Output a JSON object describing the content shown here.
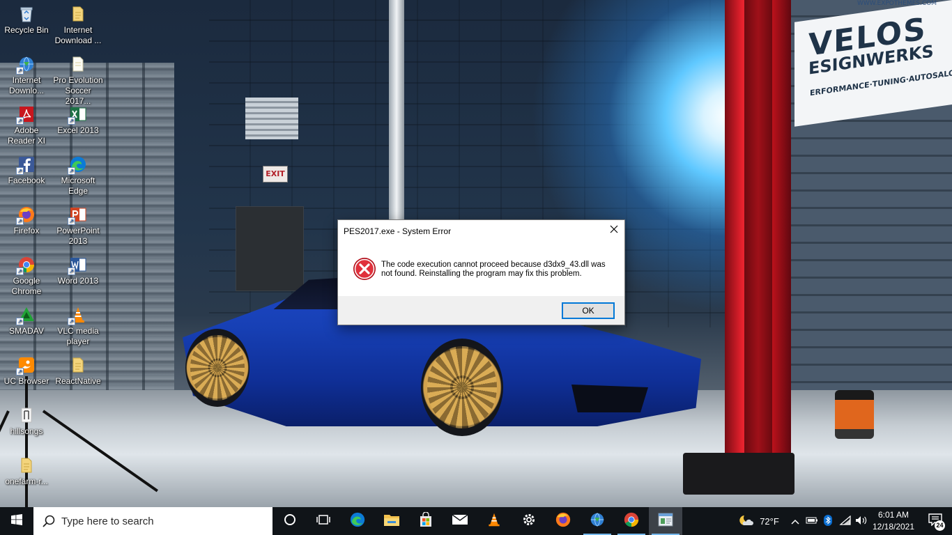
{
  "desktop": {
    "icons": [
      {
        "label": "Recycle Bin",
        "icon": "recycle-bin-icon"
      },
      {
        "label": "Internet Download ...",
        "icon": "folder-icon"
      },
      {
        "label": "Internet Downlo...",
        "icon": "internet-download-manager-icon"
      },
      {
        "label": "Pro Evolution Soccer 2017...",
        "icon": "folder-icon"
      },
      {
        "label": "Adobe Reader XI",
        "icon": "adobe-reader-icon"
      },
      {
        "label": "Excel 2013",
        "icon": "excel-icon"
      },
      {
        "label": "Facebook",
        "icon": "facebook-icon"
      },
      {
        "label": "Microsoft Edge",
        "icon": "edge-icon"
      },
      {
        "label": "Firefox",
        "icon": "firefox-icon"
      },
      {
        "label": "PowerPoint 2013",
        "icon": "powerpoint-icon"
      },
      {
        "label": "Google Chrome",
        "icon": "chrome-icon"
      },
      {
        "label": "Word 2013",
        "icon": "word-icon"
      },
      {
        "label": "SMADAV",
        "icon": "smadav-icon"
      },
      {
        "label": "VLC media player",
        "icon": "vlc-icon"
      },
      {
        "label": "UC Browser",
        "icon": "uc-browser-icon"
      },
      {
        "label": "ReactNative",
        "icon": "folder-icon"
      },
      {
        "label": "hillsongs",
        "icon": "file-icon"
      },
      {
        "label": "onefarm-r...",
        "icon": "folder-icon"
      }
    ]
  },
  "wallpaper": {
    "exit_sign": "EXIT",
    "sign_line1": "VELOS",
    "sign_line2": "ESIGNWERKS",
    "sign_line3": "ERFORMANCE·TUNING·AUTOSALON",
    "sign_url": "WWW.EXPOTHEMES.COM"
  },
  "dialog": {
    "title": "PES2017.exe - System Error",
    "message": "The code execution cannot proceed because d3dx9_43.dll was not found. Reinstalling the program may fix this problem.",
    "ok_label": "OK",
    "close_icon": "close-icon",
    "status_icon": "error-icon"
  },
  "taskbar": {
    "search_placeholder": "Type here to search",
    "apps": [
      "cortana-icon",
      "task-view-icon",
      "edge-icon",
      "file-explorer-icon",
      "store-icon",
      "mail-icon",
      "vlc-icon",
      "settings-icon",
      "firefox-icon",
      "internet-download-manager-icon",
      "chrome-icon",
      "active-window-icon"
    ],
    "weather": "72°F",
    "time": "6:01 AM",
    "date": "12/18/2021",
    "notification_count": "24"
  },
  "colors": {
    "taskbar_bg": "#101418",
    "accent": "#0078d7",
    "error_red": "#d3212d",
    "dialog_footer": "#f0f0f0"
  }
}
